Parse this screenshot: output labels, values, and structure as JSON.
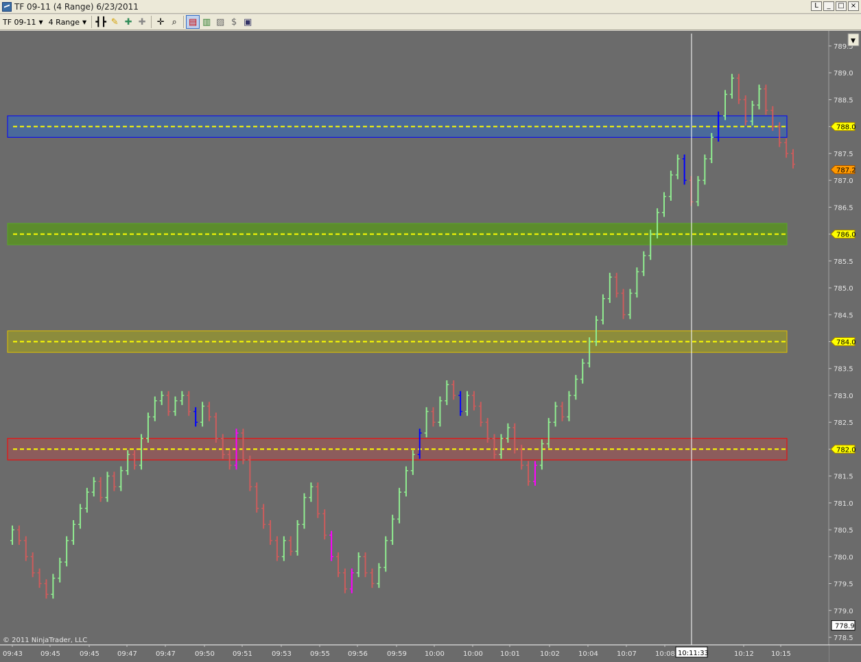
{
  "window": {
    "title": "TF 09-11 (4 Range)  6/23/2011",
    "buttons": {
      "help": "L",
      "minimize": "_",
      "maximize": "□",
      "close": "×"
    }
  },
  "toolbar": {
    "instrument": "TF 09-11",
    "period": "4 Range",
    "icons": [
      "bar-style-icon",
      "draw-pencil-icon",
      "zoom-in-icon",
      "zoom-out-icon",
      "crosshair-icon",
      "magnify-icon",
      "chart-trader-icon",
      "bar-chart-icon",
      "data-box-icon",
      "properties-icon",
      "panel-icon"
    ]
  },
  "colors": {
    "background": "#6b6b6b",
    "up_bar": "#90ee90",
    "down_bar": "#cd5c5c",
    "neutral_bar": "#0000ff",
    "special_bar": "#ff00ff",
    "zone_blue": "#4a6a9a",
    "zone_green": "#5c8c2c",
    "zone_yellow": "#8c8c3c",
    "zone_red": "#8c5c5c",
    "dashed": "#ffff00"
  },
  "chart_data": {
    "type": "ohlc",
    "x_labels": [
      "09:43",
      "09:45",
      "09:45",
      "09:47",
      "09:47",
      "09:50",
      "09:51",
      "09:53",
      "09:55",
      "09:56",
      "09:59",
      "10:00",
      "10:00",
      "10:01",
      "10:02",
      "10:04",
      "10:07",
      "10:08",
      "10:11:33",
      "10:12",
      "10:15"
    ],
    "y_ticks": [
      "789.5",
      "789.0",
      "788.5",
      "788.0",
      "787.5",
      "787.0",
      "786.5",
      "786.0",
      "785.5",
      "785.0",
      "784.5",
      "784.0",
      "783.5",
      "783.0",
      "782.5",
      "782.0",
      "781.5",
      "781.0",
      "780.5",
      "780.0",
      "779.5",
      "779.0",
      "778.5"
    ],
    "ylim": [
      778.4,
      789.6
    ],
    "zones": [
      {
        "name": "blue",
        "low": 787.8,
        "high": 788.2,
        "line": 788.0,
        "label": "788.0",
        "color": "blue"
      },
      {
        "name": "green",
        "low": 785.8,
        "high": 786.2,
        "line": 786.0,
        "label": "786.0",
        "color": "green"
      },
      {
        "name": "yellow",
        "low": 783.8,
        "high": 784.2,
        "line": 784.0,
        "label": "784.0",
        "color": "yellow"
      },
      {
        "name": "red",
        "low": 781.8,
        "high": 782.2,
        "line": 782.0,
        "label": "782.0",
        "color": "red"
      }
    ],
    "last_price": "787.2",
    "crosshair_price": "778.9",
    "crosshair_time": "10:11:33",
    "closes": [
      780.5,
      780.3,
      780.0,
      779.7,
      779.5,
      779.3,
      779.6,
      779.9,
      780.3,
      780.6,
      780.9,
      781.2,
      781.4,
      781.1,
      781.5,
      781.3,
      781.6,
      781.9,
      781.7,
      782.2,
      782.6,
      782.9,
      783.0,
      782.7,
      782.9,
      783.0,
      782.7,
      782.5,
      782.8,
      782.6,
      782.2,
      781.9,
      781.7,
      782.3,
      781.8,
      781.3,
      780.9,
      780.6,
      780.3,
      780.0,
      780.3,
      780.1,
      780.6,
      781.1,
      781.3,
      780.8,
      780.4,
      780.0,
      779.7,
      779.4,
      779.7,
      780.0,
      779.7,
      779.5,
      779.8,
      780.3,
      780.7,
      781.2,
      781.6,
      781.9,
      782.3,
      782.7,
      782.5,
      782.9,
      783.2,
      783.0,
      782.7,
      783.0,
      782.8,
      782.5,
      782.2,
      781.9,
      782.2,
      782.4,
      782.0,
      781.7,
      781.4,
      781.7,
      782.1,
      782.5,
      782.8,
      782.6,
      783.0,
      783.3,
      783.6,
      784.0,
      784.4,
      784.8,
      785.2,
      784.9,
      784.5,
      784.9,
      785.3,
      785.6,
      786.0,
      786.4,
      786.7,
      787.1,
      787.4,
      787.0,
      786.6,
      787.0,
      787.4,
      787.8,
      788.2,
      788.6,
      788.9,
      788.5,
      788.1,
      788.4,
      788.7,
      788.3,
      788.0,
      787.7,
      787.5,
      787.3
    ]
  }
}
